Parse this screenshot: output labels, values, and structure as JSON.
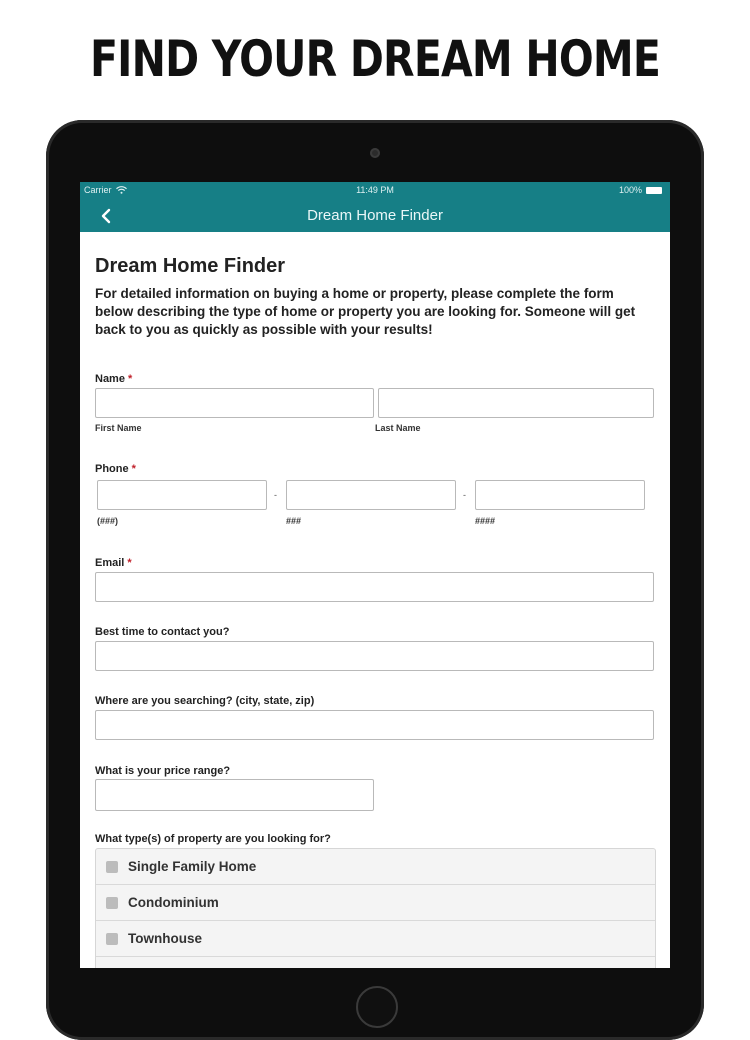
{
  "promo": {
    "headline": "FIND YOUR DREAM HOME"
  },
  "status_bar": {
    "carrier": "Carrier",
    "time": "11:49 PM",
    "battery": "100%"
  },
  "nav": {
    "title": "Dream Home Finder"
  },
  "form": {
    "title": "Dream Home Finder",
    "intro": "For detailed information on buying a home or property, please complete the form below describing the type of home or property you are looking for. Someone will get back to you as quickly as possible with your results!",
    "name": {
      "label": "Name",
      "required_mark": "*",
      "first_sublabel": "First Name",
      "last_sublabel": "Last Name",
      "first_value": "",
      "last_value": ""
    },
    "phone": {
      "label": "Phone",
      "required_mark": "*",
      "area_sublabel": "(###)",
      "prefix_sublabel": "###",
      "line_sublabel": "####",
      "separator": "-"
    },
    "email": {
      "label": "Email",
      "required_mark": "*",
      "value": ""
    },
    "best_time": {
      "label": "Best time to contact you?",
      "value": ""
    },
    "searching": {
      "label": "Where are you searching? (city, state, zip)",
      "value": ""
    },
    "price": {
      "label": "What is your price range?",
      "value": ""
    },
    "property_types": {
      "label": "What type(s) of property are you looking for?",
      "options": [
        {
          "label": "Single Family Home",
          "checked": false
        },
        {
          "label": "Condominium",
          "checked": false
        },
        {
          "label": "Townhouse",
          "checked": false
        }
      ]
    }
  }
}
